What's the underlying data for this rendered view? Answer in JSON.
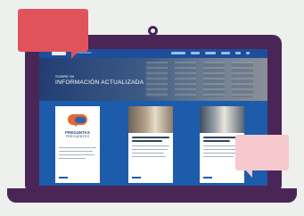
{
  "site": {
    "nav": {
      "brand": "UNIVERSIDAD",
      "menu_items": [
        "",
        "",
        "",
        "",
        "",
        ""
      ]
    },
    "hero": {
      "kicker": "SOBRE MI",
      "title": "INFORMACIÓN ACTUALIZADA"
    },
    "cards": {
      "faq": {
        "title": "PREGUNTAS",
        "subtitle": "FRECUENTES"
      }
    }
  },
  "colors": {
    "laptop": "#4a2656",
    "bubble_red": "#e0535b",
    "bubble_pink": "#f6c9cf",
    "site_blue": "#1c5cab",
    "faq_accent": "#e8662f"
  }
}
